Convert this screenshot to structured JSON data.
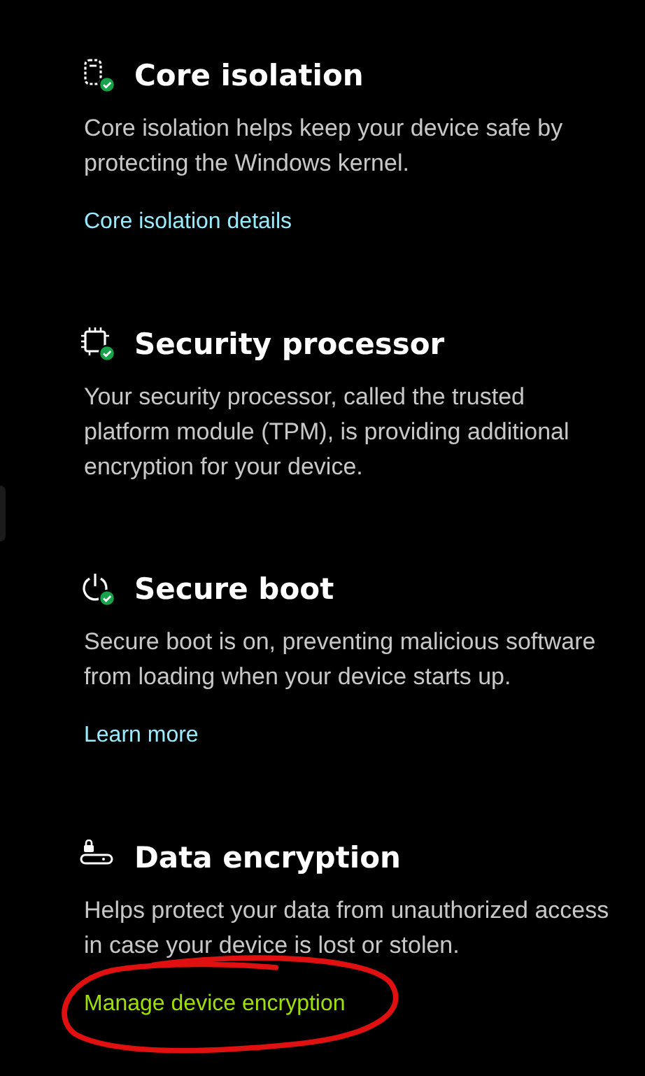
{
  "sections": [
    {
      "kind": "chip",
      "title": "Core isolation",
      "description": "Core isolation helps keep your device safe by protecting the Windows kernel.",
      "link": {
        "label": "Core isolation details",
        "color": "#99ebff",
        "circled": false
      }
    },
    {
      "kind": "processor",
      "title": "Security processor",
      "description": "Your security processor, called the trusted platform module (TPM), is providing additional encryption for your device."
    },
    {
      "kind": "power",
      "title": "Secure boot",
      "description": "Secure boot is on, preventing malicious software from loading when your device starts up.",
      "link": {
        "label": "Learn more",
        "color": "#99ebff",
        "circled": false
      }
    },
    {
      "kind": "drive",
      "title": "Data encryption",
      "description": "Helps protect your data from unauthorized access in case your device is lost or stolen.",
      "link": {
        "label": "Manage device encryption",
        "color": "#9ee000",
        "circled": true
      }
    }
  ]
}
